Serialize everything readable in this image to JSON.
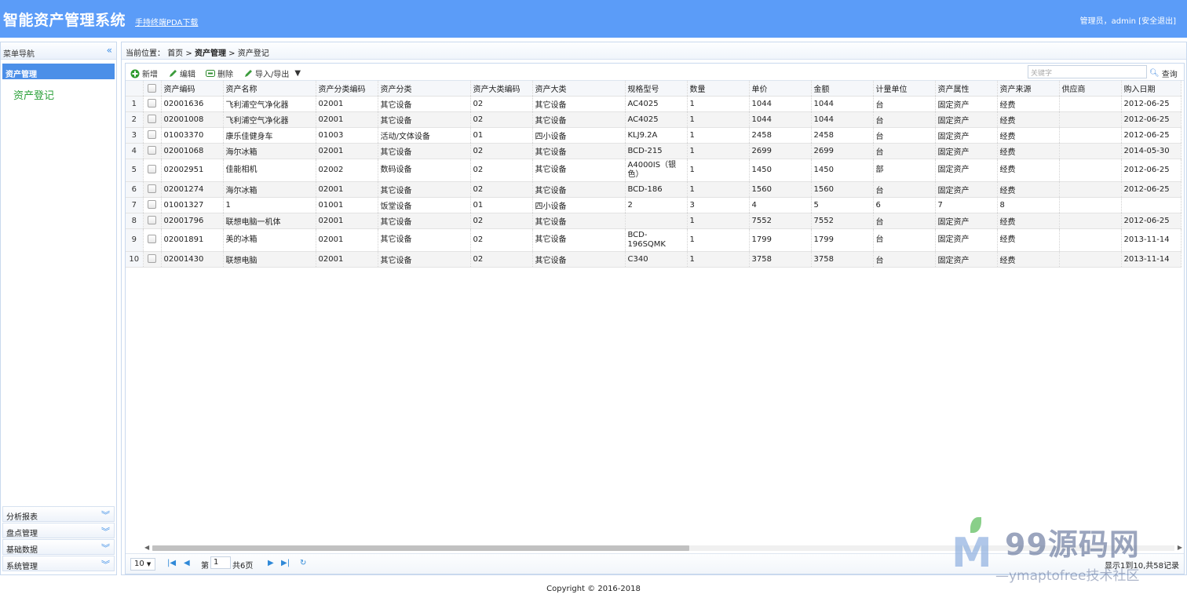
{
  "header": {
    "title": "智能资产管理系统",
    "pda_link": "手持终端PDA下载",
    "user": "管理员，admin [安全退出]"
  },
  "sidebar": {
    "title": "菜单导航",
    "collapse_icon": "double-chevron-left-icon",
    "active_panel": "资产管理",
    "active_item": "资产登记",
    "panels": [
      {
        "label": "分析报表"
      },
      {
        "label": "盘点管理"
      },
      {
        "label": "基础数据"
      },
      {
        "label": "系统管理"
      }
    ],
    "expand_icon": "double-chevron-down-icon"
  },
  "breadcrumb": {
    "prefix": "当前位置：",
    "home": "首页",
    "sep": ">",
    "section": "资产管理",
    "page": "资产登记"
  },
  "toolbar": {
    "add": "新增",
    "edit": "编辑",
    "delete": "删除",
    "import_export": "导入/导出",
    "search_placeholder": "关键字",
    "search_button": "查询"
  },
  "table": {
    "columns": [
      "资产编码",
      "资产名称",
      "资产分类编码",
      "资产分类",
      "资产大类编码",
      "资产大类",
      "规格型号",
      "数量",
      "单价",
      "金额",
      "计量单位",
      "资产属性",
      "资产来源",
      "供应商",
      "购入日期"
    ],
    "rows": [
      {
        "n": "1",
        "code": "02001636",
        "name": "飞利浦空气净化器",
        "cat_code": "02001",
        "cat": "其它设备",
        "big_code": "02",
        "big": "其它设备",
        "model": "AC4025",
        "qty": "1",
        "price": "1044",
        "amount": "1044",
        "unit": "台",
        "attr": "固定资产",
        "source": "经费",
        "supplier": "",
        "date": "2012-06-25"
      },
      {
        "n": "2",
        "code": "02001008",
        "name": "飞利浦空气净化器",
        "cat_code": "02001",
        "cat": "其它设备",
        "big_code": "02",
        "big": "其它设备",
        "model": "AC4025",
        "qty": "1",
        "price": "1044",
        "amount": "1044",
        "unit": "台",
        "attr": "固定资产",
        "source": "经费",
        "supplier": "",
        "date": "2012-06-25"
      },
      {
        "n": "3",
        "code": "01003370",
        "name": "康乐佳健身车",
        "cat_code": "01003",
        "cat": "活动/文体设备",
        "big_code": "01",
        "big": "四小设备",
        "model": "KLJ9.2A",
        "qty": "1",
        "price": "2458",
        "amount": "2458",
        "unit": "台",
        "attr": "固定资产",
        "source": "经费",
        "supplier": "",
        "date": "2012-06-25"
      },
      {
        "n": "4",
        "code": "02001068",
        "name": "海尔冰箱",
        "cat_code": "02001",
        "cat": "其它设备",
        "big_code": "02",
        "big": "其它设备",
        "model": "BCD-215",
        "qty": "1",
        "price": "2699",
        "amount": "2699",
        "unit": "台",
        "attr": "固定资产",
        "source": "经费",
        "supplier": "",
        "date": "2014-05-30"
      },
      {
        "n": "5",
        "code": "02002951",
        "name": "佳能相机",
        "cat_code": "02002",
        "cat": "数码设备",
        "big_code": "02",
        "big": "其它设备",
        "model": "A4000IS（银色）",
        "qty": "1",
        "price": "1450",
        "amount": "1450",
        "unit": "部",
        "attr": "固定资产",
        "source": "经费",
        "supplier": "",
        "date": "2012-06-25"
      },
      {
        "n": "6",
        "code": "02001274",
        "name": "海尔冰箱",
        "cat_code": "02001",
        "cat": "其它设备",
        "big_code": "02",
        "big": "其它设备",
        "model": "BCD-186",
        "qty": "1",
        "price": "1560",
        "amount": "1560",
        "unit": "台",
        "attr": "固定资产",
        "source": "经费",
        "supplier": "",
        "date": "2012-06-25"
      },
      {
        "n": "7",
        "code": "01001327",
        "name": "1",
        "cat_code": "01001",
        "cat": "饭堂设备",
        "big_code": "01",
        "big": "四小设备",
        "model": "2",
        "qty": "3",
        "price": "4",
        "amount": "5",
        "unit": "6",
        "attr": "7",
        "source": "8",
        "supplier": "",
        "date": ""
      },
      {
        "n": "8",
        "code": "02001796",
        "name": "联想电脑一机体",
        "cat_code": "02001",
        "cat": "其它设备",
        "big_code": "02",
        "big": "其它设备",
        "model": "",
        "qty": "1",
        "price": "7552",
        "amount": "7552",
        "unit": "台",
        "attr": "固定资产",
        "source": "经费",
        "supplier": "",
        "date": "2012-06-25"
      },
      {
        "n": "9",
        "code": "02001891",
        "name": "美的冰箱",
        "cat_code": "02001",
        "cat": "其它设备",
        "big_code": "02",
        "big": "其它设备",
        "model": "BCD-196SQMK",
        "qty": "1",
        "price": "1799",
        "amount": "1799",
        "unit": "台",
        "attr": "固定资产",
        "source": "经费",
        "supplier": "",
        "date": "2013-11-14"
      },
      {
        "n": "10",
        "code": "02001430",
        "name": "联想电脑",
        "cat_code": "02001",
        "cat": "其它设备",
        "big_code": "02",
        "big": "其它设备",
        "model": "C340",
        "qty": "1",
        "price": "3758",
        "amount": "3758",
        "unit": "台",
        "attr": "固定资产",
        "source": "经费",
        "supplier": "",
        "date": "2013-11-14"
      }
    ]
  },
  "pager": {
    "page_size": "10",
    "page_label": "第",
    "page": "1",
    "total_pages": "共6页",
    "info": "显示1到10,共58记录"
  },
  "footer": "Copyright © 2016-2018",
  "watermark": {
    "logo": "M",
    "text": "99源码网",
    "sub": "—ymaptofree技术社区"
  }
}
